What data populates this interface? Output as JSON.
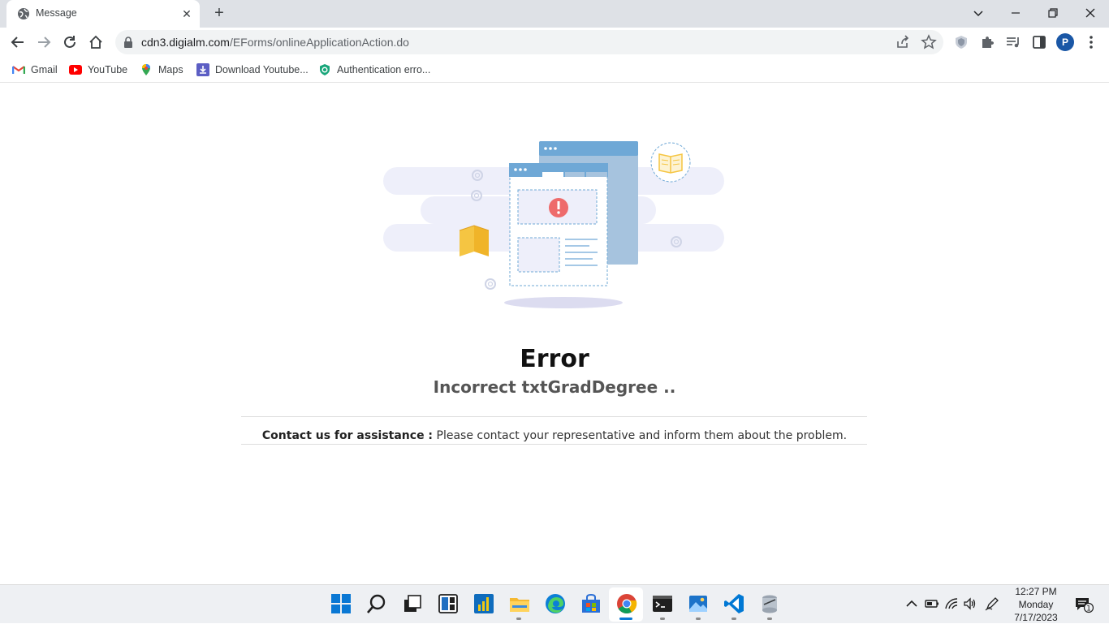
{
  "browser": {
    "tab": {
      "title": "Message",
      "close": "✕"
    },
    "new_tab": "+",
    "window_controls": {
      "dropdown": "⌄",
      "minimize": "—",
      "restore": "❐",
      "close": "✕"
    },
    "url": {
      "host": "cdn3.digialm.com",
      "path": "/EForms/onlineApplicationAction.do"
    },
    "profile_initial": "P",
    "bookmarks": [
      {
        "label": "Gmail",
        "icon": "gmail-icon"
      },
      {
        "label": "YouTube",
        "icon": "youtube-icon"
      },
      {
        "label": "Maps",
        "icon": "maps-icon"
      },
      {
        "label": "Download Youtube...",
        "icon": "download-icon"
      },
      {
        "label": "Authentication erro...",
        "icon": "shield-icon"
      }
    ]
  },
  "page": {
    "error_title": "Error",
    "error_message": "Incorrect txtGradDegree ..",
    "contact_label": "Contact us for assistance :",
    "contact_text": " Please contact your representative and inform them about the problem."
  },
  "taskbar": {
    "clock": {
      "time": "12:27 PM",
      "day": "Monday",
      "date": "7/17/2023"
    },
    "notification_count": "1"
  },
  "colors": {
    "accent_blue": "#6fa8d6",
    "error_red": "#ee6b6b",
    "book_yellow": "#f5c542"
  }
}
